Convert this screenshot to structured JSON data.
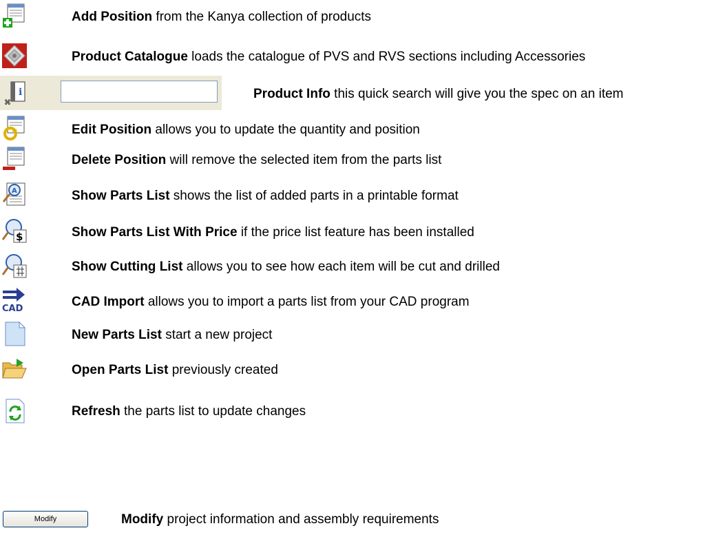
{
  "items": [
    {
      "bold": "Add Position",
      "rest": " from the Kanya collection of products",
      "icon": "add-position-icon"
    },
    {
      "bold": "Product Catalogue",
      "rest": " loads the catalogue of PVS and RVS sections including Accessories",
      "icon": "product-catalogue-icon"
    },
    {
      "bold": "Product Info",
      "rest": " this quick search will give you the spec on an item",
      "icon": "product-info-icon"
    },
    {
      "bold": "Edit Position",
      "rest": " allows you to update the quantity and position",
      "icon": "edit-position-icon"
    },
    {
      "bold": "Delete Position",
      "rest": " will remove the selected item from the parts list",
      "icon": "delete-position-icon"
    },
    {
      "bold": "Show Parts List",
      "rest": " shows the list of added parts in a printable format",
      "icon": "show-parts-list-icon"
    },
    {
      "bold": "Show Parts List With Price",
      "rest": " if the price list feature has been installed",
      "icon": "show-price-list-icon"
    },
    {
      "bold": "Show Cutting List",
      "rest": " allows you to see how each item will be cut and drilled",
      "icon": "show-cutting-list-icon"
    },
    {
      "bold": "CAD Import",
      "rest": " allows you to import a parts list from your CAD program",
      "icon": "cad-import-icon"
    },
    {
      "bold": "New Parts List",
      "rest": " start a new project",
      "icon": "new-parts-list-icon"
    },
    {
      "bold": "Open Parts List",
      "rest": " previously created",
      "icon": "open-folder-icon"
    },
    {
      "bold": "Refresh",
      "rest": " the parts list to update changes",
      "icon": "refresh-icon"
    },
    {
      "bold": "Modify",
      "rest": " project information and assembly requirements",
      "icon": "modify-button"
    }
  ],
  "search": {
    "value": "",
    "placeholder": ""
  },
  "modify_button_label": "Modify",
  "colors": {
    "toolbar_bg": "#ece9d8",
    "input_border": "#7f9db9",
    "accent_blue": "#2a5db0",
    "add_green": "#1fa31f",
    "delete_red": "#c0201a"
  }
}
